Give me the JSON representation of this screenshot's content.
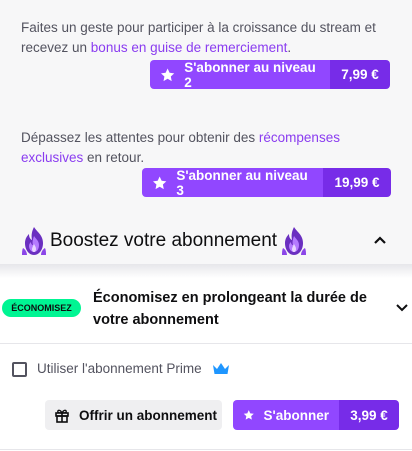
{
  "tier2": {
    "text_before": "Faites un geste pour participer à la croissance du stream et recevez un ",
    "link": "bonus en guise de remerciement",
    "text_after": ".",
    "button_label": "S'abonner au niveau 2",
    "price": "7,99 €"
  },
  "tier3": {
    "text_before": "Dépassez les attentes pour obtenir des ",
    "link": "récompenses exclusives",
    "text_after": " en retour.",
    "button_label": "S'abonner au niveau 3",
    "price": "19,99 €"
  },
  "boost": {
    "title": "Boostez votre abonnement"
  },
  "savings": {
    "badge": "ÉCONOMISEZ",
    "text": "Économisez en prolongeant la durée de votre abonnement"
  },
  "prime": {
    "label": "Utiliser l'abonnement Prime",
    "checked": false
  },
  "actions": {
    "gift_label": "Offrir un abonnement",
    "subscribe_label": "S'abonner",
    "subscribe_price": "3,99 €"
  },
  "colors": {
    "accent": "#9147ff",
    "accent_dark": "#772ce8",
    "link": "#8a3cf0",
    "savings_badge": "#00f593",
    "prime_crown": "#1e96ff"
  },
  "icons": [
    "star-icon",
    "flame-emote-icon",
    "chevron-up-icon",
    "chevron-down-icon",
    "crown-icon",
    "gift-icon"
  ]
}
